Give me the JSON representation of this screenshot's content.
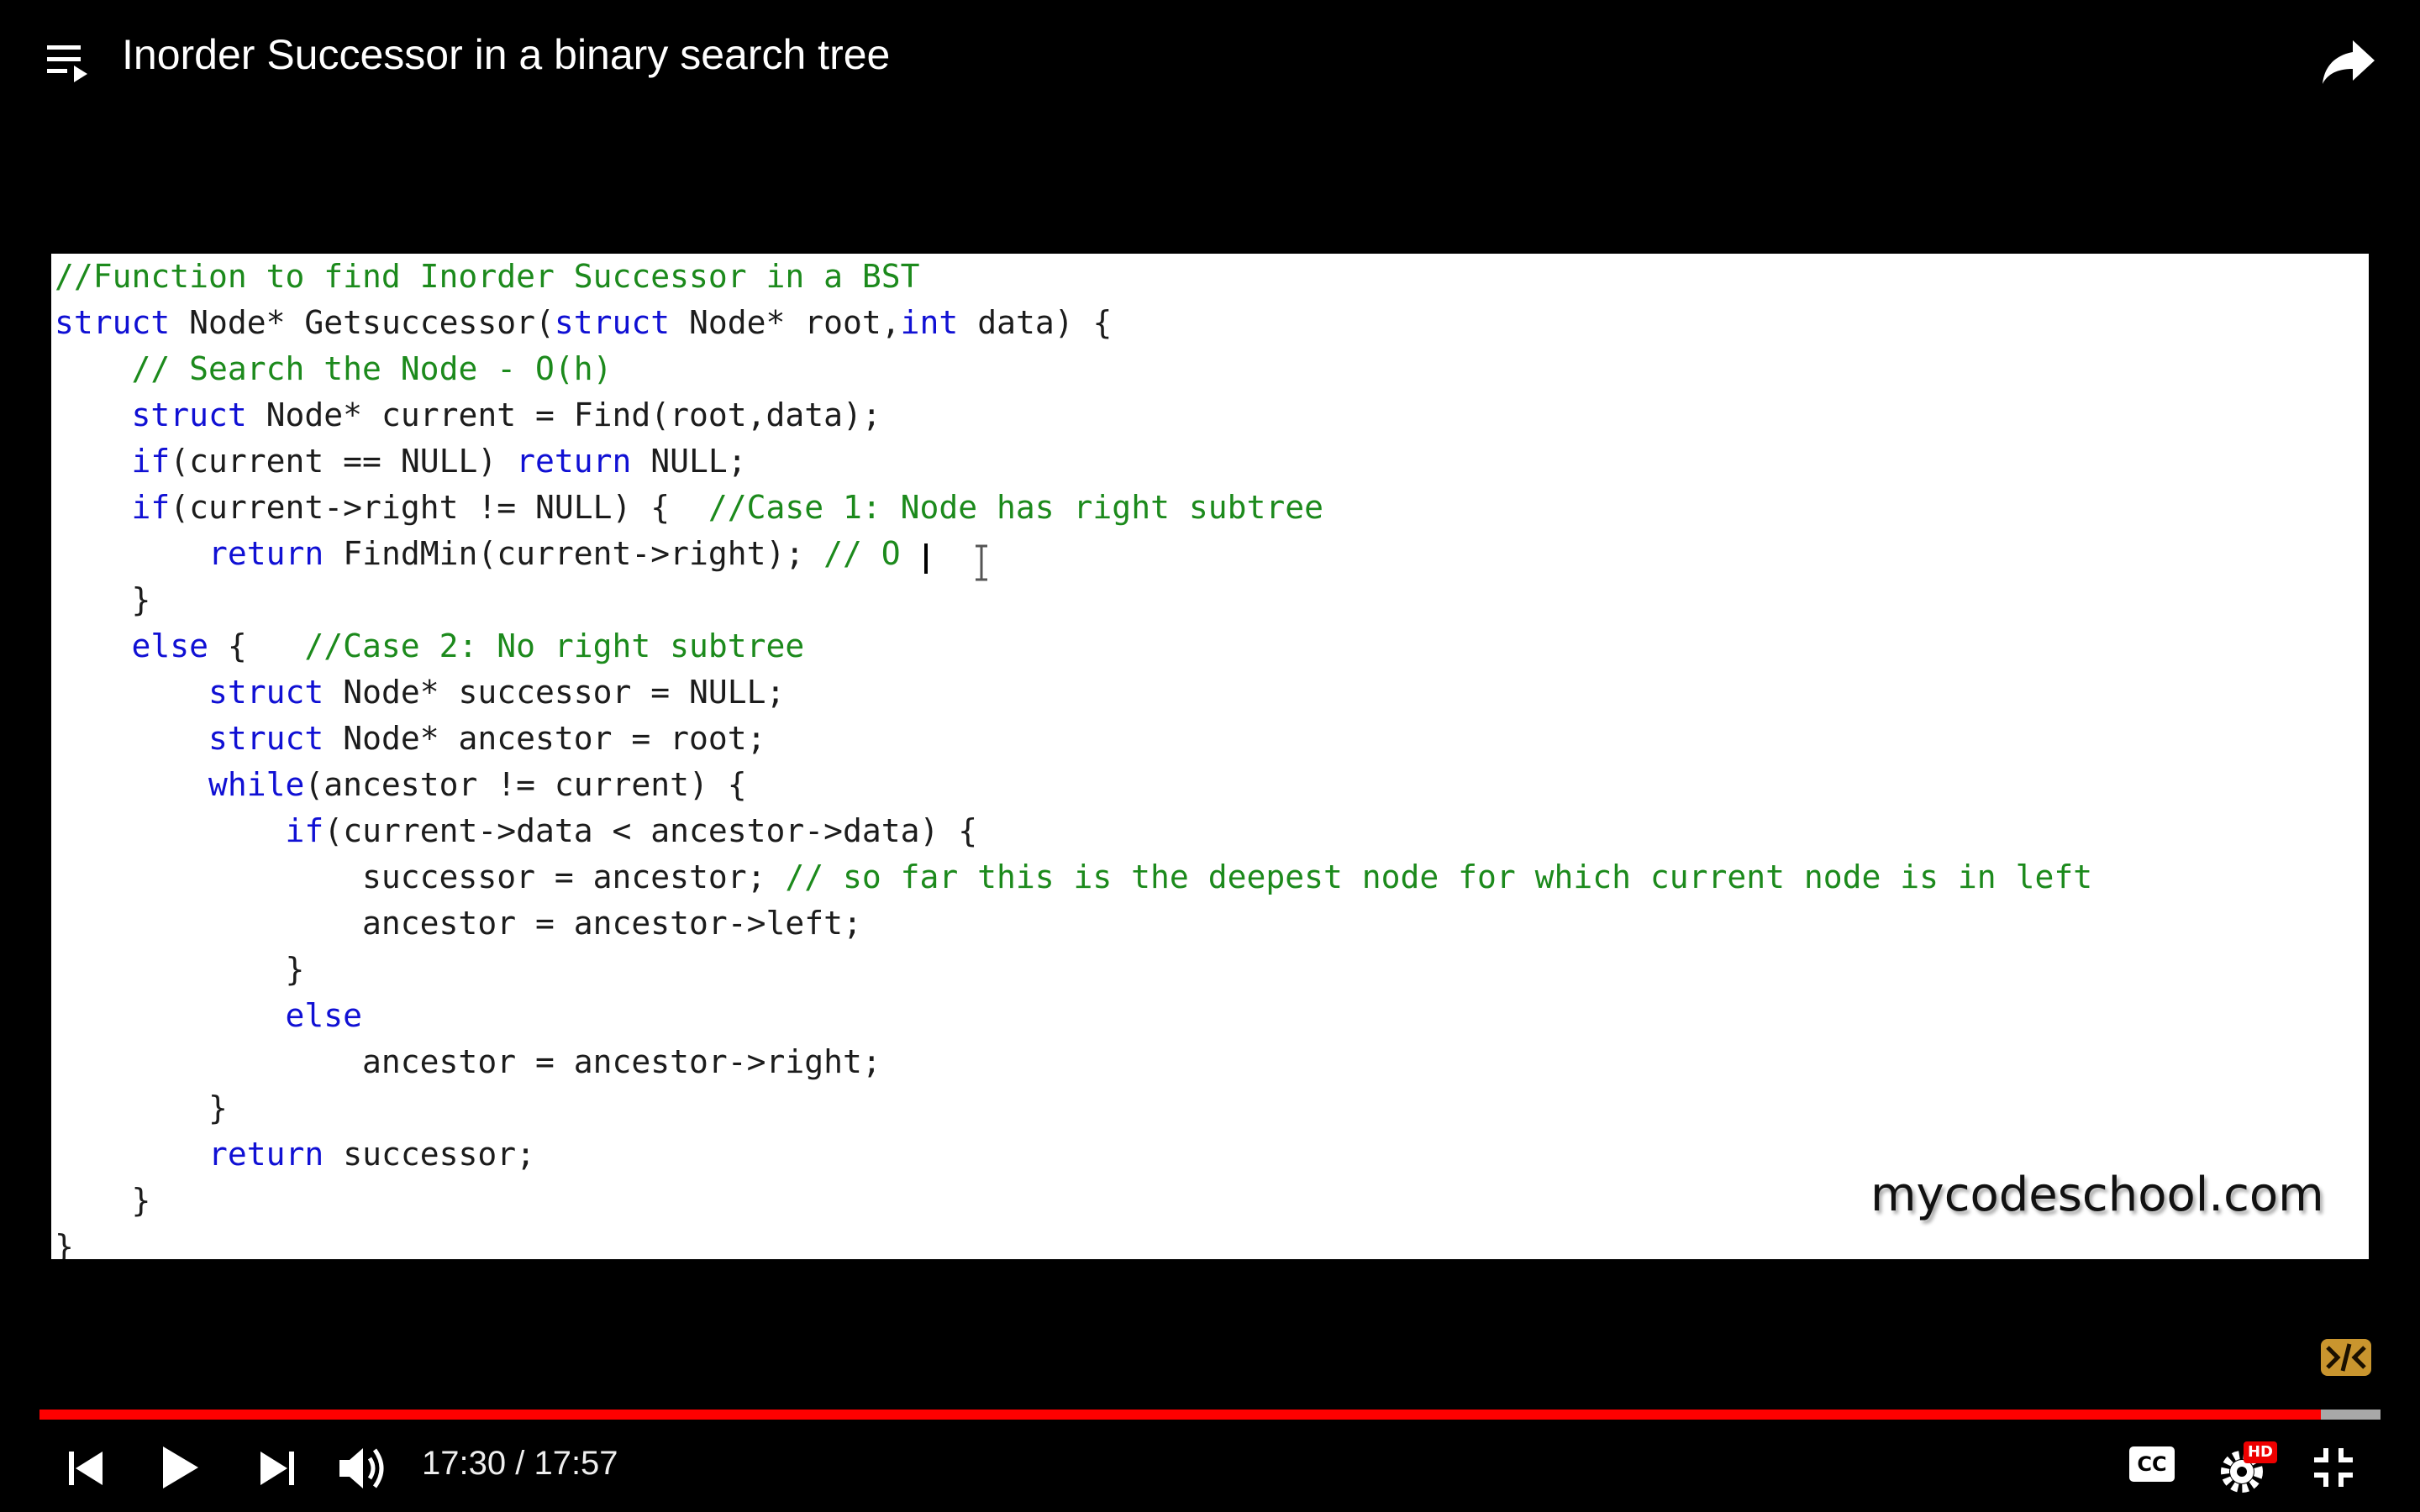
{
  "header": {
    "title": "Inorder Successor in a binary search tree"
  },
  "slide": {
    "code_lines": [
      [
        {
          "t": "//Function to find Inorder Successor in a BST",
          "c": "cm"
        }
      ],
      [
        {
          "t": "struct",
          "c": "kw"
        },
        {
          "t": " Node* Getsuccessor("
        },
        {
          "t": "struct",
          "c": "kw"
        },
        {
          "t": " Node* root,"
        },
        {
          "t": "int",
          "c": "kw"
        },
        {
          "t": " data) {"
        }
      ],
      [
        {
          "t": "    "
        },
        {
          "t": "// Search the Node - O(h)",
          "c": "cm"
        }
      ],
      [
        {
          "t": "    "
        },
        {
          "t": "struct",
          "c": "kw"
        },
        {
          "t": " Node* current = Find(root,data);"
        }
      ],
      [
        {
          "t": "    "
        },
        {
          "t": "if",
          "c": "kw"
        },
        {
          "t": "(current == NULL) "
        },
        {
          "t": "return",
          "c": "kw"
        },
        {
          "t": " NULL;"
        }
      ],
      [
        {
          "t": "    "
        },
        {
          "t": "if",
          "c": "kw"
        },
        {
          "t": "(current->right != NULL) {  "
        },
        {
          "t": "//Case 1: Node has right subtree",
          "c": "cm"
        }
      ],
      [
        {
          "t": "        "
        },
        {
          "t": "return",
          "c": "kw"
        },
        {
          "t": " FindMin(current->right); "
        },
        {
          "t": "// O",
          "c": "cm"
        }
      ],
      [
        {
          "t": "    }"
        }
      ],
      [
        {
          "t": "    "
        },
        {
          "t": "else",
          "c": "kw"
        },
        {
          "t": " {   "
        },
        {
          "t": "//Case 2: No right subtree",
          "c": "cm"
        }
      ],
      [
        {
          "t": "        "
        },
        {
          "t": "struct",
          "c": "kw"
        },
        {
          "t": " Node* successor = NULL;"
        }
      ],
      [
        {
          "t": "        "
        },
        {
          "t": "struct",
          "c": "kw"
        },
        {
          "t": " Node* ancestor = root;"
        }
      ],
      [
        {
          "t": "        "
        },
        {
          "t": "while",
          "c": "kw"
        },
        {
          "t": "(ancestor != current) {"
        }
      ],
      [
        {
          "t": "            "
        },
        {
          "t": "if",
          "c": "kw"
        },
        {
          "t": "(current->data < ancestor->data) {"
        }
      ],
      [
        {
          "t": "                successor = ancestor; "
        },
        {
          "t": "// so far this is the deepest node for which current node is in left",
          "c": "cm"
        }
      ],
      [
        {
          "t": "                ancestor = ancestor->left;"
        }
      ],
      [
        {
          "t": "            }"
        }
      ],
      [
        {
          "t": "            "
        },
        {
          "t": "else",
          "c": "kw"
        }
      ],
      [
        {
          "t": "                ancestor = ancestor->right;"
        }
      ],
      [
        {
          "t": "        }"
        }
      ],
      [
        {
          "t": "        "
        },
        {
          "t": "return",
          "c": "kw"
        },
        {
          "t": " successor;"
        }
      ],
      [
        {
          "t": "    }"
        }
      ],
      [
        {
          "t": "}"
        }
      ]
    ],
    "watermark": "mycodeschool.com"
  },
  "player": {
    "current_time": "17:30",
    "separator": " / ",
    "duration": "17:57",
    "progress_fraction": 0.9745,
    "accent": "#ff0000"
  },
  "icons": {
    "playlist": "playlist-icon",
    "share": "share-icon",
    "prev": "skip-previous-icon",
    "play": "play-icon",
    "next": "skip-next-icon",
    "volume": "volume-icon",
    "captions": "captions-icon",
    "settings": "settings-icon",
    "hd_badge": "HD",
    "exit_fullscreen": "exit-fullscreen-icon",
    "captions_label": "CC"
  }
}
